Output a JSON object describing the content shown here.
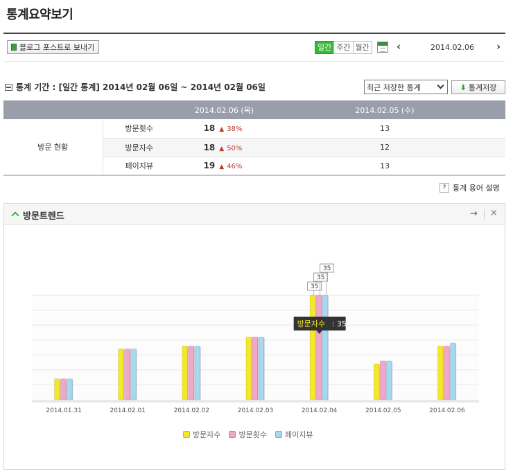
{
  "page": {
    "title": "통계요약보기"
  },
  "toolbar": {
    "blog_post_label": "블로그 포스트로 보내기",
    "tabs": [
      "일간",
      "주간",
      "월간"
    ],
    "prev": "‹",
    "next": "›",
    "date": "2014.02.06"
  },
  "period": {
    "label": "통계 기간 : [일간 통계] 2014년 02월 06일 ~ 2014년 02월 06일",
    "select_value": "최근 저장한 통계",
    "save_label": "통계저장"
  },
  "table": {
    "col_today": "2014.02.06 (목)",
    "col_prev": "2014.02.05 (수)",
    "group_label": "방문 현황",
    "rows": [
      {
        "metric": "방문횟수",
        "today": "18",
        "change": "38%",
        "prev": "13"
      },
      {
        "metric": "방문자수",
        "today": "18",
        "change": "50%",
        "prev": "12"
      },
      {
        "metric": "페이지뷰",
        "today": "19",
        "change": "46%",
        "prev": "13"
      }
    ]
  },
  "glossary": {
    "icon": "?",
    "label": "통계 용어 설명"
  },
  "trend": {
    "title": "방문트렌드",
    "arrow": "→",
    "close": "×"
  },
  "chart_data": {
    "type": "bar",
    "categories": [
      "2014.01.31",
      "2014.02.01",
      "2014.02.02",
      "2014.02.03",
      "2014.02.04",
      "2014.02.05",
      "2014.02.06"
    ],
    "series": [
      {
        "name": "방문자수",
        "color": "#f5e82a",
        "values": [
          7,
          17,
          18,
          21,
          35,
          12,
          18
        ]
      },
      {
        "name": "방문횟수",
        "color": "#f4a6c9",
        "values": [
          7,
          17,
          18,
          21,
          35,
          13,
          18
        ]
      },
      {
        "name": "페이지뷰",
        "color": "#a6d8f2",
        "values": [
          7,
          17,
          18,
          21,
          35,
          13,
          19
        ]
      }
    ],
    "ylim": [
      0,
      35
    ],
    "grid": true,
    "legend": "bottom",
    "tooltip": {
      "series": "방문자수",
      "sep": " : ",
      "value": "35"
    },
    "data_labels": [
      "35",
      "35",
      "35"
    ]
  }
}
